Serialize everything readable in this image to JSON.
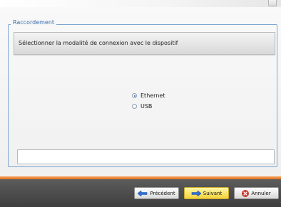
{
  "group": {
    "title": "Raccordement"
  },
  "instruction": "Sélectionner la modalité de connexion avec le dispositif",
  "connection_options": [
    {
      "label": "Ethernet",
      "selected": true
    },
    {
      "label": "USB",
      "selected": false
    }
  ],
  "status_field": {
    "value": ""
  },
  "buttons": {
    "previous": "Précédent",
    "next": "Suivant",
    "cancel": "Annuler"
  },
  "colors": {
    "accent": "#e2701e",
    "frame": "#7fa6d2",
    "primary_button": "#f3d23a",
    "footer": "#4a4a4a"
  }
}
